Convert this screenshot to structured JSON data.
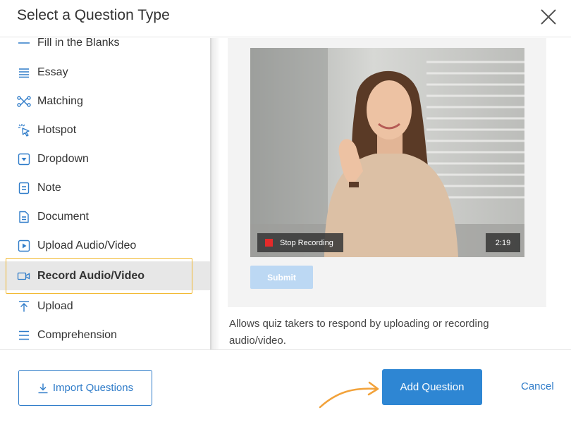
{
  "modal": {
    "title": "Select a Question Type"
  },
  "colors": {
    "accent": "#2e86d3",
    "selected_outline": "#f2b82f",
    "record_red": "#e42a2a",
    "annotation_arrow": "#f2a23a"
  },
  "question_types": [
    {
      "label": "Fill in the Blanks",
      "icon": "dash-icon"
    },
    {
      "label": "Essay",
      "icon": "lines-icon"
    },
    {
      "label": "Matching",
      "icon": "matching-icon"
    },
    {
      "label": "Hotspot",
      "icon": "hotspot-cursor-icon"
    },
    {
      "label": "Dropdown",
      "icon": "dropdown-icon"
    },
    {
      "label": "Note",
      "icon": "note-icon"
    },
    {
      "label": "Document",
      "icon": "document-icon"
    },
    {
      "label": "Upload Audio/Video",
      "icon": "play-box-icon"
    },
    {
      "label": "Record Audio/Video",
      "icon": "video-camera-icon",
      "selected": true
    },
    {
      "label": "Upload",
      "icon": "upload-arrow-icon"
    },
    {
      "label": "Comprehension",
      "icon": "comprehension-lines-icon"
    }
  ],
  "preview": {
    "stop_recording_label": "Stop Recording",
    "timer": "2:19",
    "submit_label": "Submit",
    "description": "Allows quiz takers to respond by uploading or recording audio/video."
  },
  "footer": {
    "import_label": "Import Questions",
    "add_label": "Add Question",
    "cancel_label": "Cancel"
  }
}
